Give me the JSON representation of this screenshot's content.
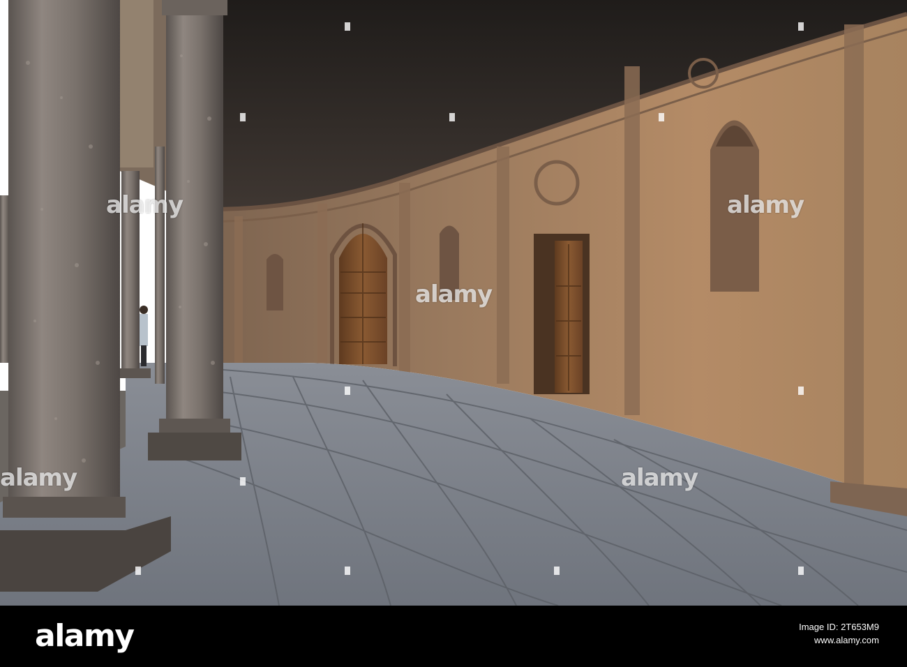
{
  "photo": {
    "subject": "palace-courtyard-colonnade"
  },
  "watermarks": [
    "alamy",
    "alamy",
    "alamy",
    "alamy",
    "alamy"
  ],
  "footer": {
    "logo": "alamy",
    "image_id_label": "Image ID: 2T653M9",
    "site": "www.alamy.com"
  },
  "colors": {
    "footer_bg": "#000000",
    "wall": "#a9825f",
    "floor": "#7b8088",
    "ceiling": "#2e2a27"
  }
}
